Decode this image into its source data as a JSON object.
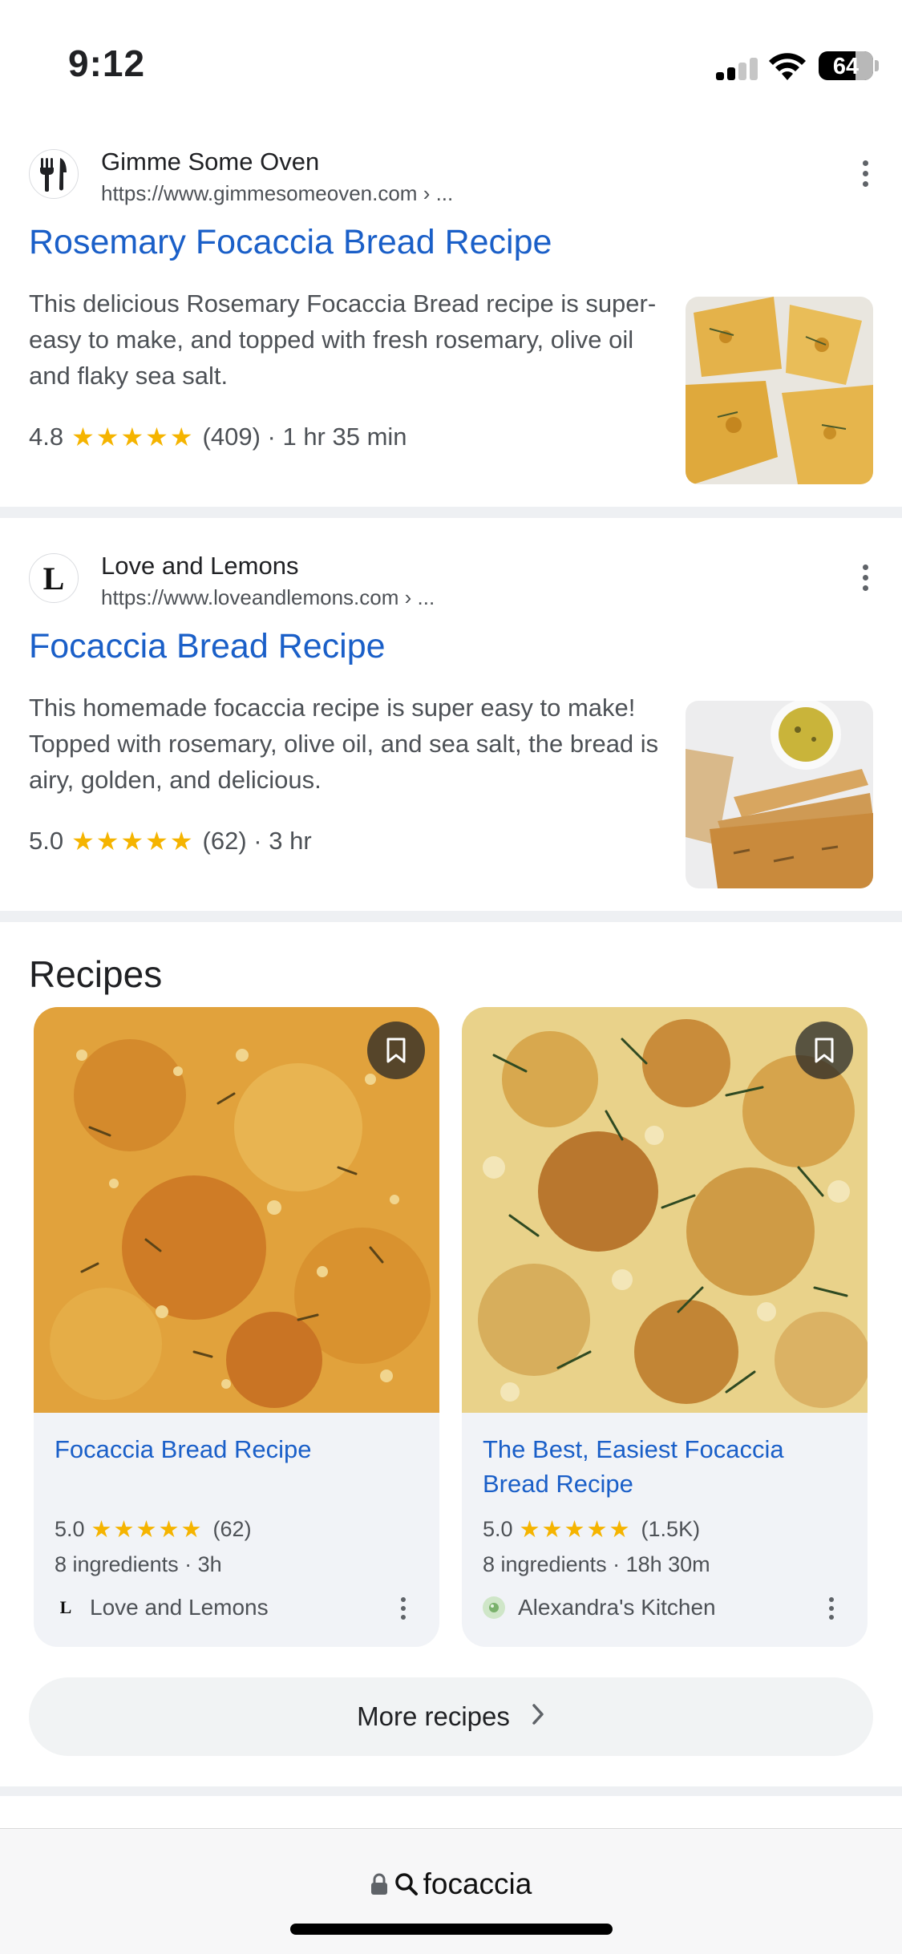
{
  "status_bar": {
    "time": "9:12",
    "battery": "64"
  },
  "results": [
    {
      "site_name": "Gimme Some Oven",
      "url": "https://www.gimmesomeoven.com › ...",
      "title": "Rosemary Focaccia Bread Recipe",
      "snippet": "This delicious Rosemary Focaccia Bread recipe is super-easy to make, and topped with fresh rosemary, olive oil and flaky sea salt.",
      "rating": "4.8",
      "stars": "★★★★★",
      "details": "(409) · 1 hr 35 min"
    },
    {
      "site_name": "Love and Lemons",
      "favicon_letter": "L",
      "url": "https://www.loveandlemons.com › ...",
      "title": "Focaccia Bread Recipe",
      "snippet": "This homemade focaccia recipe is super easy to make! Topped with rosemary, olive oil, and sea salt, the bread is airy, golden, and delicious.",
      "rating": "5.0",
      "stars": "★★★★★",
      "details": "(62) · 3 hr"
    }
  ],
  "recipes": {
    "heading": "Recipes",
    "cards": [
      {
        "title": "Focaccia Bread Recipe",
        "rating": "5.0",
        "stars": "★★★★★",
        "count": "(62)",
        "meta": "8 ingredients · 3h",
        "source_letter": "L",
        "source": "Love and Lemons"
      },
      {
        "title": "The Best, Easiest Focaccia Bread Recipe",
        "rating": "5.0",
        "stars": "★★★★★",
        "count": "(1.5K)",
        "meta": "8 ingredients · 18h 30m",
        "source": "Alexandra's Kitchen"
      }
    ],
    "more_label": "More recipes"
  },
  "address_bar": {
    "query": "focaccia"
  },
  "colors": {
    "link": "#1a5fc8",
    "star": "#f5b400",
    "separator": "#eef0f3"
  },
  "icons": [
    "fork-knife-icon",
    "kebab-menu-icon",
    "bookmark-icon",
    "chevron-right-icon",
    "lock-icon",
    "search-icon",
    "wifi-icon",
    "signal-icon",
    "battery-icon"
  ]
}
